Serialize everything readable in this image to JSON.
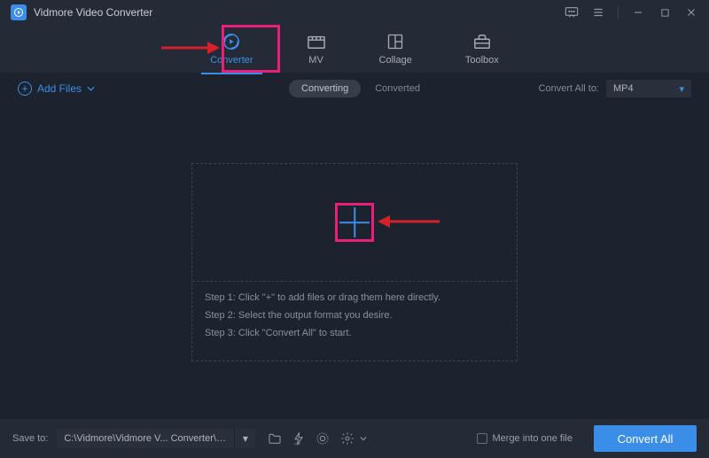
{
  "titlebar": {
    "app_name": "Vidmore Video Converter"
  },
  "nav": {
    "tabs": [
      {
        "label": "Converter",
        "active": true
      },
      {
        "label": "MV"
      },
      {
        "label": "Collage"
      },
      {
        "label": "Toolbox"
      }
    ]
  },
  "subbar": {
    "add_files": "Add Files",
    "converting": "Converting",
    "converted": "Converted",
    "convert_all_label": "Convert All to:",
    "format_selected": "MP4"
  },
  "steps": {
    "s1": "Step 1: Click \"+\" to add files or drag them here directly.",
    "s2": "Step 2: Select the output format you desire.",
    "s3": "Step 3: Click \"Convert All\" to start."
  },
  "bottombar": {
    "save_label": "Save to:",
    "path": "C:\\Vidmore\\Vidmore V... Converter\\Converted",
    "merge_label": "Merge into one file",
    "convert_btn": "Convert All"
  }
}
